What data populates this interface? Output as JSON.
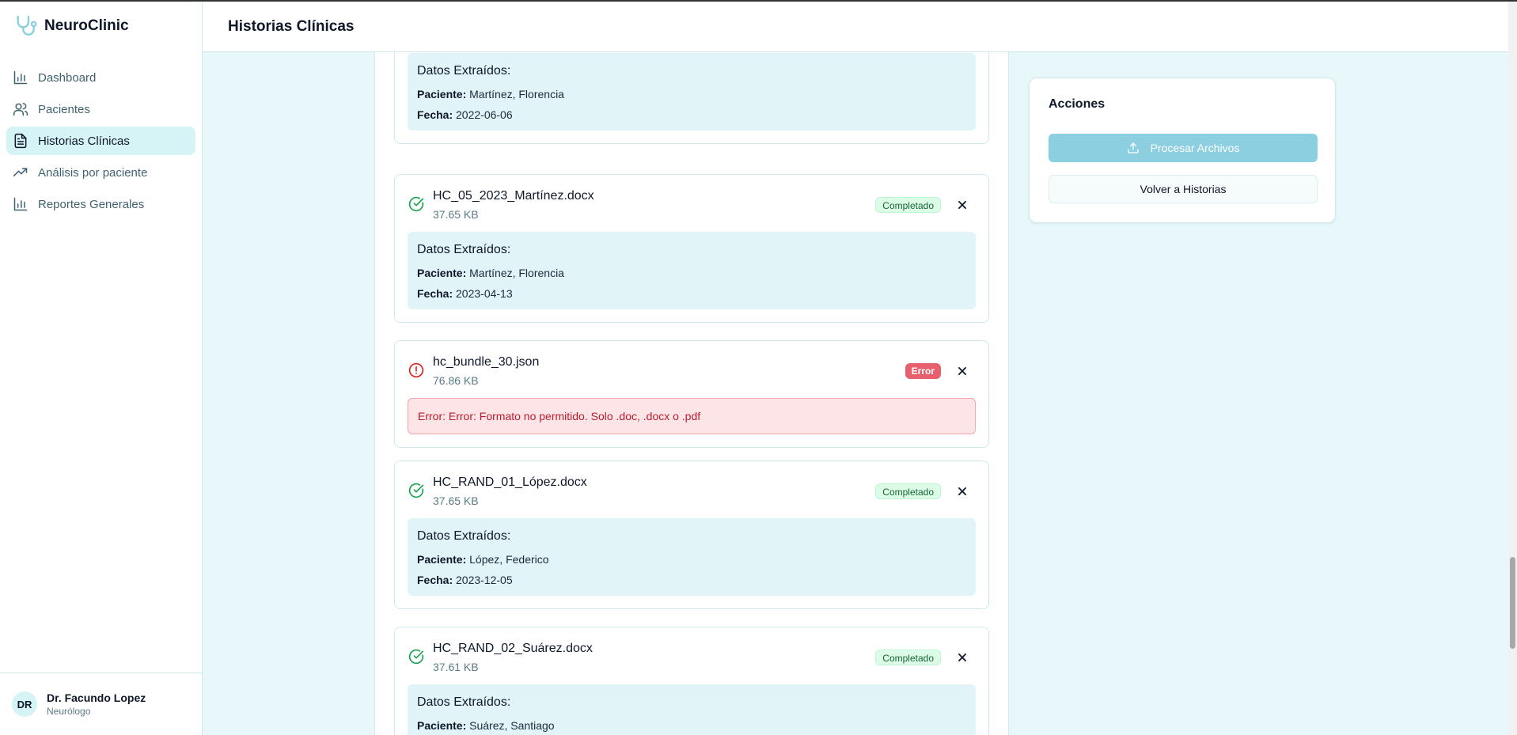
{
  "app": {
    "name": "NeuroClinic"
  },
  "sidebar": {
    "items": [
      {
        "label": "Dashboard",
        "icon": "bar-chart-icon",
        "active": false
      },
      {
        "label": "Pacientes",
        "icon": "users-icon",
        "active": false
      },
      {
        "label": "Historias Clínicas",
        "icon": "file-text-icon",
        "active": true
      },
      {
        "label": "Análisis por paciente",
        "icon": "trending-up-icon",
        "active": false
      },
      {
        "label": "Reportes Generales",
        "icon": "bar-chart-icon",
        "active": false
      }
    ],
    "profile": {
      "initials": "DR",
      "name": "Dr. Facundo Lopez",
      "role": "Neurólogo"
    }
  },
  "header": {
    "title": "Historias Clínicas"
  },
  "files": [
    {
      "extract_title": "Datos Extraídos:",
      "patient_label": "Paciente:",
      "patient": "Martínez, Florencia",
      "date_label": "Fecha:",
      "date": "2022-06-06"
    },
    {
      "name": "HC_05_2023_Martínez.docx",
      "size": "37.65 KB",
      "status": "Completado",
      "extract_title": "Datos Extraídos:",
      "patient_label": "Paciente:",
      "patient": "Martínez, Florencia",
      "date_label": "Fecha:",
      "date": "2023-04-13"
    },
    {
      "name": "hc_bundle_30.json",
      "size": "76.86 KB",
      "status": "Error",
      "error": "Error: Error: Formato no permitido. Solo .doc, .docx o .pdf"
    },
    {
      "name": "HC_RAND_01_López.docx",
      "size": "37.65 KB",
      "status": "Completado",
      "extract_title": "Datos Extraídos:",
      "patient_label": "Paciente:",
      "patient": "López, Federico",
      "date_label": "Fecha:",
      "date": "2023-12-05"
    },
    {
      "name": "HC_RAND_02_Suárez.docx",
      "size": "37.61 KB",
      "status": "Completado",
      "extract_title": "Datos Extraídos:",
      "patient_label": "Paciente:",
      "patient": "Suárez, Santiago"
    }
  ],
  "actions": {
    "title": "Acciones",
    "process_label": "Procesar Archivos",
    "back_label": "Volver a Historias"
  },
  "colors": {
    "brand_teal": "#8ccfe0",
    "success": "#16a34a",
    "error": "#dc2626",
    "background": "#e8f8fa"
  }
}
